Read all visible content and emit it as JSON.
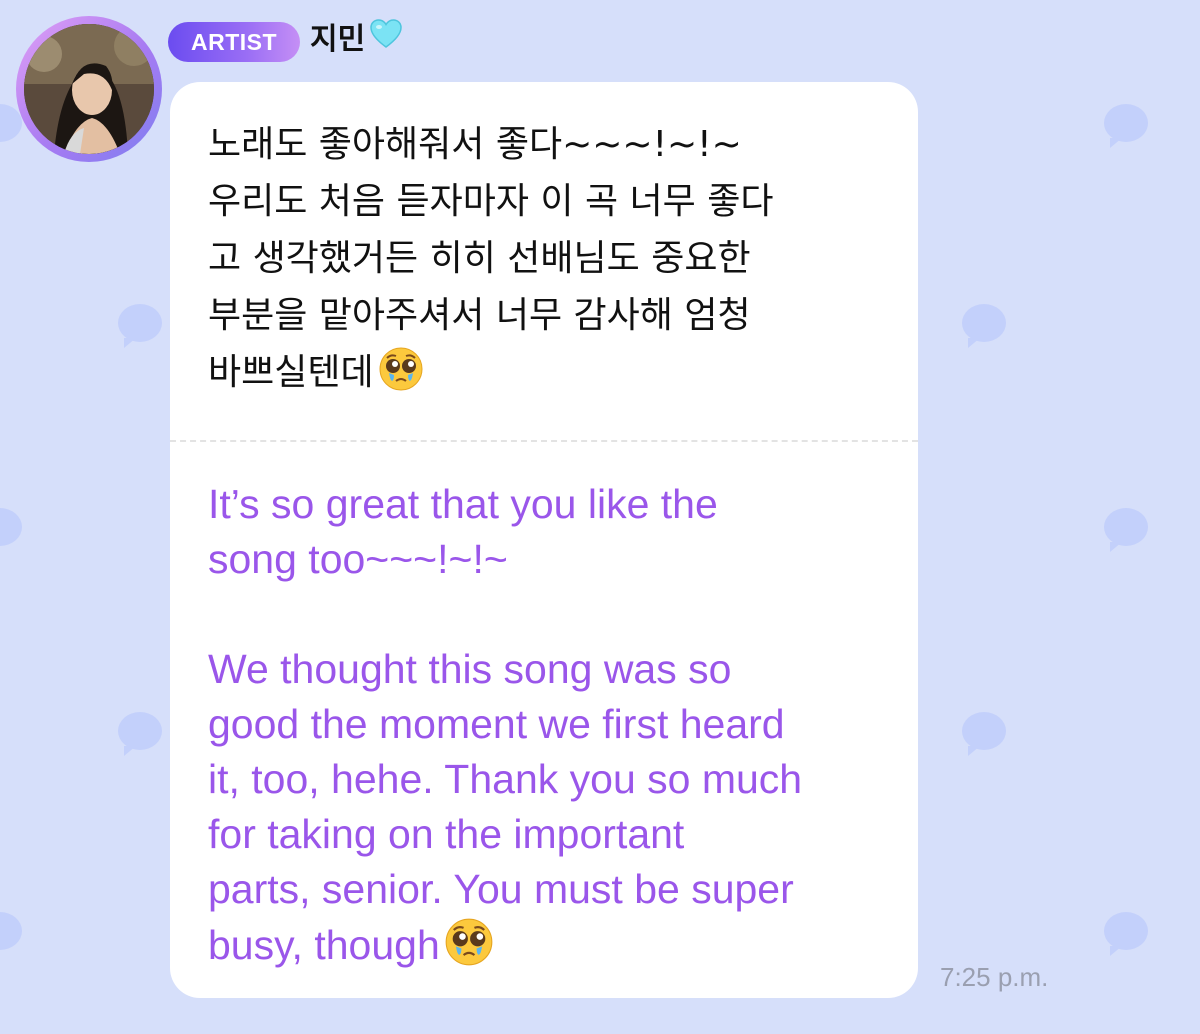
{
  "sender": {
    "badge": "ARTIST",
    "name": "지민"
  },
  "message": {
    "original": "노래도 좋아해줘서 좋다~~~!~!~\n우리도 처음 듣자마자 이 곡 너무 좋다\n고 생각했거든 히히 선배님도 중요한\n부분을 맡아주셔서 너무 감사해 엄청\n바쁘실텐데",
    "translation": "It’s so great that you like the\nsong too~~~!~!~\n\nWe thought this song was so\ngood the moment we first heard\nit, too, hehe. Thank you so much\nfor taking on the important\nparts, senior. You must be super\nbusy, though",
    "timestamp": "7:25 p.m."
  },
  "icons": {
    "name_suffix": "light-blue-heart-icon",
    "message_emoji": "pleading-face-icon"
  },
  "colors": {
    "background": "#d6dffa",
    "bubble": "#ffffff",
    "translation_text": "#9a56ea",
    "badge_start": "#6b4cf0",
    "badge_end": "#c58ff5"
  }
}
